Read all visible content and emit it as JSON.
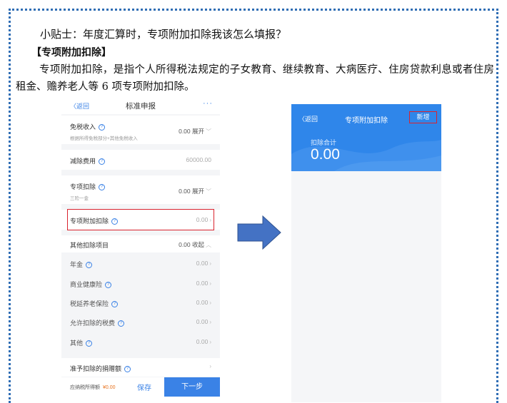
{
  "doc": {
    "tip_title": "小贴士：年度汇算时，专项附加扣除我该怎么填报？",
    "heading": "【专项附加扣除】",
    "paragraph": "专项附加扣除，是指个人所得税法规定的子女教育、继续教育、大病医疗、住房贷款利息或者住房租金、赡养老人等 6 项专项附加扣除。"
  },
  "left_screen": {
    "back": "〈返回",
    "title": "标准申报",
    "more": "···",
    "rows": [
      {
        "label": "免税收入",
        "sub": "根据所得免税部分+其他免税收入",
        "value": "0.00 展开"
      },
      {
        "label": "减除费用",
        "value": "60000.00"
      },
      {
        "label": "专项扣除",
        "sub": "三险一金",
        "value": "0.00 展开"
      },
      {
        "label": "专项附加扣除",
        "value": "0.00"
      },
      {
        "label": "其他扣除项目",
        "value": "0.00 收起"
      },
      {
        "label": "年金",
        "value": "0.00"
      },
      {
        "label": "商业健康险",
        "value": "0.00"
      },
      {
        "label": "税延养老保险",
        "value": "0.00"
      },
      {
        "label": "允许扣除的税费",
        "value": "0.00"
      },
      {
        "label": "其他",
        "value": "0.00"
      },
      {
        "label": "准予扣除的捐赠额"
      }
    ],
    "bottom": {
      "tax_label": "应纳税所得额",
      "tax_value": "¥0.00",
      "save": "保存",
      "next": "下一步"
    },
    "highlight_color": "#d9232e",
    "accent_color": "#3a82e6"
  },
  "right_screen": {
    "back": "〈返回",
    "title": "专项附加扣除",
    "add_button": "新增",
    "sum_label": "扣除合计",
    "sum_value": "0.00",
    "header_color": "#2f86ea"
  }
}
